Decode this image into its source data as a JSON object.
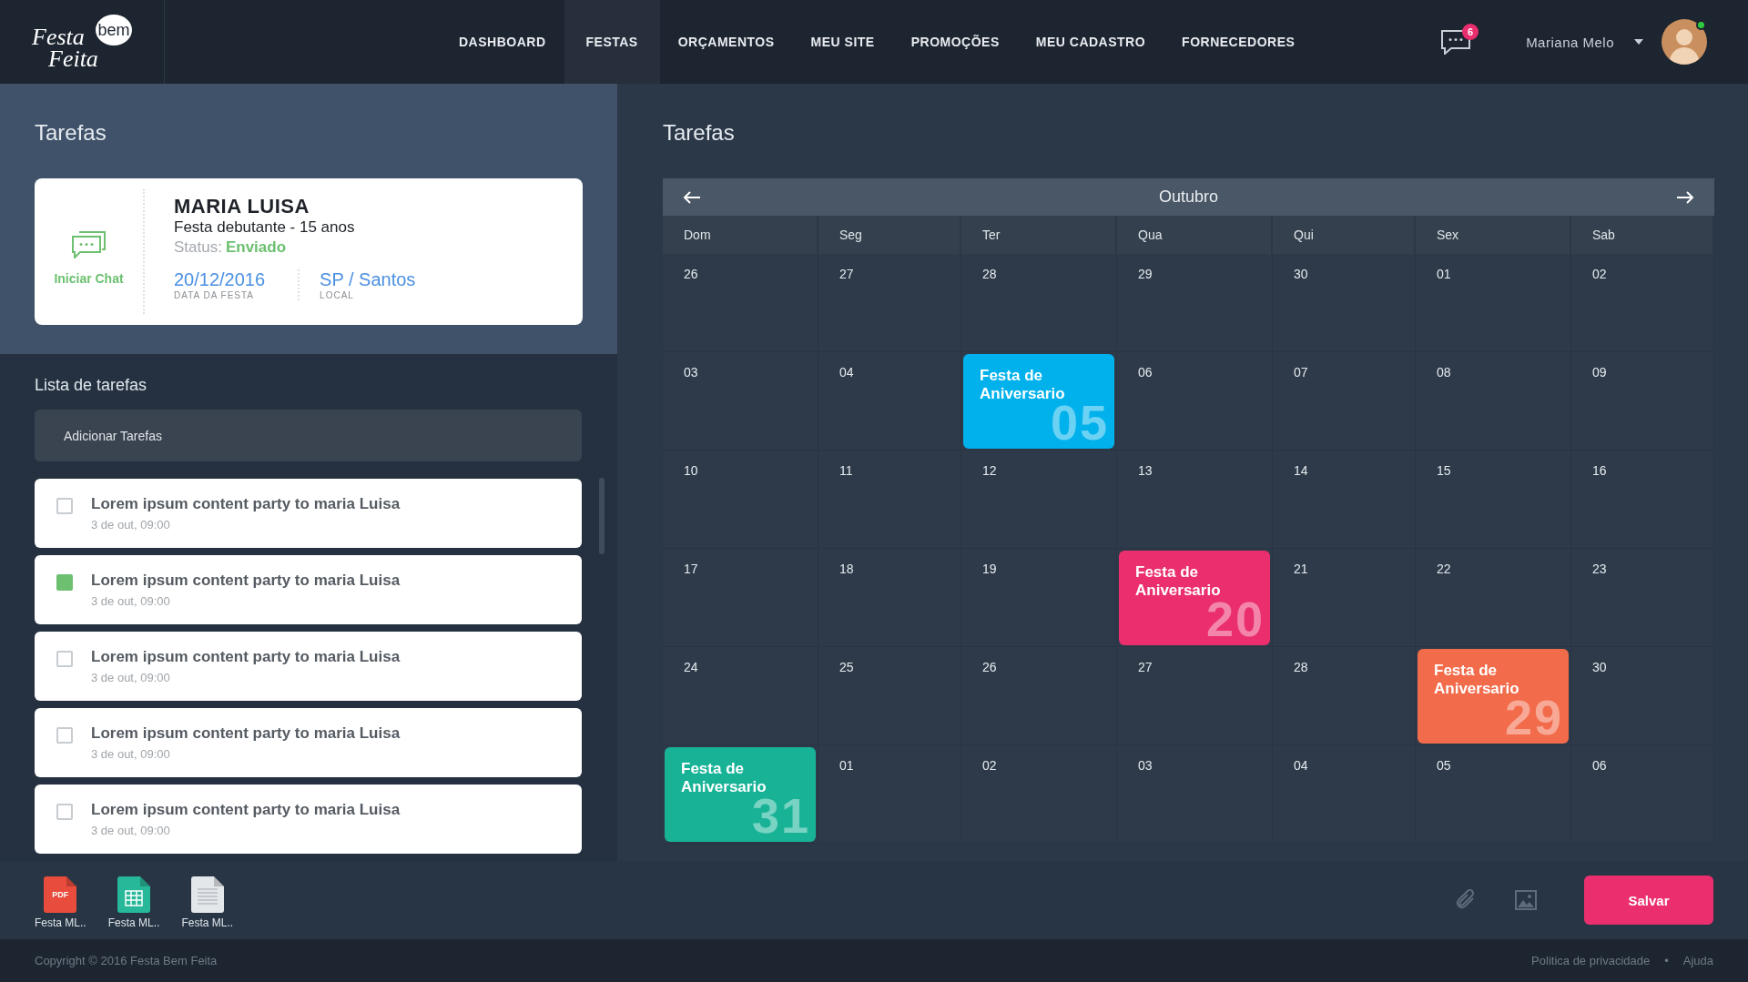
{
  "header": {
    "logo": {
      "word_1": "Festa",
      "word_2": "bem",
      "word_3": "Feita"
    },
    "nav": [
      {
        "label": "DASHBOARD",
        "selected": false
      },
      {
        "label": "FESTAS",
        "selected": true
      },
      {
        "label": "ORÇAMENTOS",
        "selected": false
      },
      {
        "label": "MEU SITE",
        "selected": false
      },
      {
        "label": "PROMOÇÕES",
        "selected": false
      },
      {
        "label": "MEU CADASTRO",
        "selected": false
      },
      {
        "label": "FORNECEDORES",
        "selected": false
      }
    ],
    "messages_badge": "6",
    "user": {
      "name": "Mariana Melo",
      "online": true
    }
  },
  "left_panel": {
    "title": "Tarefas",
    "client_card": {
      "chat_label": "Iniciar Chat",
      "name": "MARIA LUISA",
      "event": "Festa debutante - 15 anos",
      "status_label": "Status:",
      "status": "Enviado",
      "date": "20/12/2016",
      "date_caption": "DATA DA FESTA",
      "place": "SP / Santos",
      "place_caption": "LOCAL"
    },
    "list_title": "Lista de tarefas",
    "add_field": {
      "placeholder": "Adicionar Tarefas"
    },
    "tasks": [
      {
        "title": "Lorem ipsum content party to maria Luisa",
        "time": "3 de out, 09:00",
        "checked": false
      },
      {
        "title": "Lorem ipsum content party to maria Luisa",
        "time": "3 de out, 09:00",
        "checked": true
      },
      {
        "title": "Lorem ipsum content party to maria Luisa",
        "time": "3 de out, 09:00",
        "checked": false
      },
      {
        "title": "Lorem ipsum content party to maria Luisa",
        "time": "3 de out, 09:00",
        "checked": false
      },
      {
        "title": "Lorem ipsum content party to maria Luisa",
        "time": "3 de out, 09:00",
        "checked": false
      }
    ]
  },
  "right_panel": {
    "title": "Tarefas",
    "calendar": {
      "month": "Outubro",
      "weekdays": [
        "Dom",
        "Seg",
        "Ter",
        "Qua",
        "Qui",
        "Sex",
        "Sab"
      ],
      "weeks": [
        [
          {
            "day": "26"
          },
          {
            "day": "27"
          },
          {
            "day": "28"
          },
          {
            "day": "29"
          },
          {
            "day": "30"
          },
          {
            "day": "01"
          },
          {
            "day": "02"
          }
        ],
        [
          {
            "day": "03"
          },
          {
            "day": "04"
          },
          {
            "event": {
              "title": "Festa de Aniversario",
              "number": "05",
              "color": "#00b1ec"
            }
          },
          {
            "day": "06"
          },
          {
            "day": "07"
          },
          {
            "day": "08"
          },
          {
            "day": "09"
          }
        ],
        [
          {
            "day": "10"
          },
          {
            "day": "11"
          },
          {
            "day": "12"
          },
          {
            "day": "13"
          },
          {
            "day": "14"
          },
          {
            "day": "15"
          },
          {
            "day": "16"
          }
        ],
        [
          {
            "day": "17"
          },
          {
            "day": "18"
          },
          {
            "day": "19"
          },
          {
            "event": {
              "title": "Festa de Aniversario",
              "number": "20",
              "color": "#ea2e6e"
            }
          },
          {
            "day": "21"
          },
          {
            "day": "22"
          },
          {
            "day": "23"
          }
        ],
        [
          {
            "day": "24"
          },
          {
            "day": "25"
          },
          {
            "day": "26"
          },
          {
            "day": "27"
          },
          {
            "day": "28"
          },
          {
            "event": {
              "title": "Festa de Aniversario",
              "number": "29",
              "color": "#f26b4b"
            }
          },
          {
            "day": "30"
          }
        ],
        [
          {
            "event": {
              "title": "Festa de Aniversario",
              "number": "31",
              "color": "#18b397"
            }
          },
          {
            "day": "01"
          },
          {
            "day": "02"
          },
          {
            "day": "03"
          },
          {
            "day": "04"
          },
          {
            "day": "05"
          },
          {
            "day": "06"
          }
        ]
      ]
    }
  },
  "bottom_bar": {
    "files": [
      {
        "kind": "pdf",
        "badge": "PDF",
        "label": "Festa ML.."
      },
      {
        "kind": "sheet",
        "label": "Festa ML.."
      },
      {
        "kind": "doc",
        "label": "Festa ML.."
      }
    ],
    "save_button": "Salvar"
  },
  "footer": {
    "copyright": "Copyright © 2016 Festa Bem Feita",
    "links": [
      "Politica de privacidade",
      "Ajuda"
    ],
    "separator": "•"
  }
}
